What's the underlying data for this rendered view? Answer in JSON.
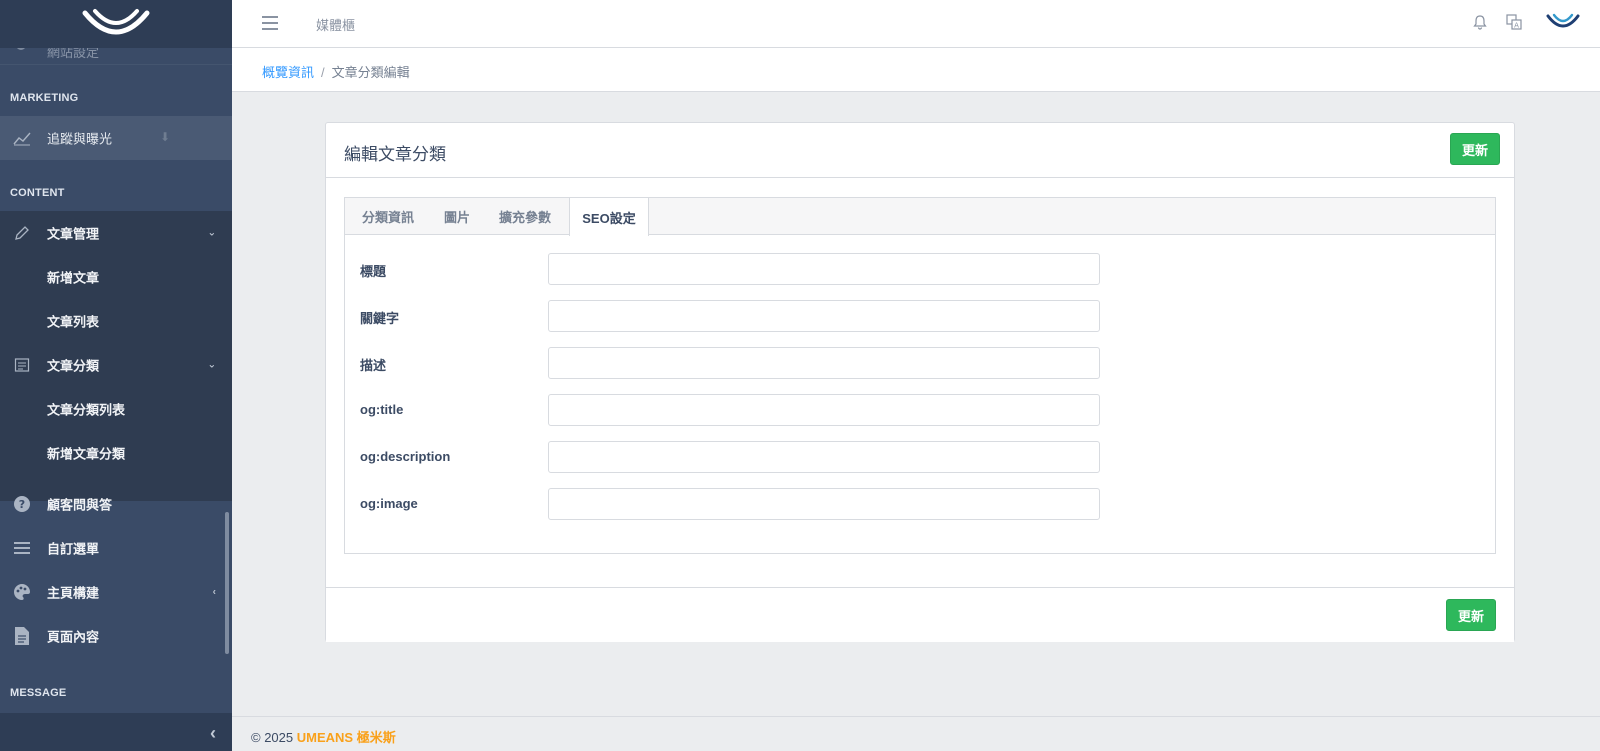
{
  "colors": {
    "sidebar": "#3a4b67",
    "accent": "#3399ff",
    "success": "#2eb85c",
    "brand_orange": "#f9a11b"
  },
  "sidebar": {
    "clipped_label": "網站設定",
    "sections": {
      "marketing": "MARKETING",
      "content": "CONTENT",
      "message": "MESSAGE"
    },
    "items": {
      "tracking": "追蹤與曝光",
      "article_mgmt": "文章管理",
      "add_article": "新增文章",
      "article_list": "文章列表",
      "article_category": "文章分類",
      "category_list": "文章分類列表",
      "add_category": "新增文章分類",
      "faq": "顧客問與答",
      "custom_menu": "自訂選單",
      "homepage_builder": "主頁構建",
      "page_content": "頁面內容"
    }
  },
  "header": {
    "nav_label": "媒體櫃"
  },
  "breadcrumb": {
    "home": "概覽資訊",
    "separator": "/",
    "current": "文章分類編輯"
  },
  "card": {
    "title": "編輯文章分類",
    "update_label": "更新",
    "tabs": [
      "分類資訊",
      "圖片",
      "擴充參數",
      "SEO設定"
    ],
    "active_tab": "SEO設定",
    "fields": {
      "title": {
        "label": "標題",
        "value": ""
      },
      "keywords": {
        "label": "關鍵字",
        "value": ""
      },
      "description": {
        "label": "描述",
        "value": ""
      },
      "og_title": {
        "label": "og:title",
        "value": ""
      },
      "og_description": {
        "label": "og:description",
        "value": ""
      },
      "og_image": {
        "label": "og:image",
        "value": ""
      }
    }
  },
  "footer": {
    "copyright": "© 2025",
    "brand": "UMEANS 極米斯"
  }
}
